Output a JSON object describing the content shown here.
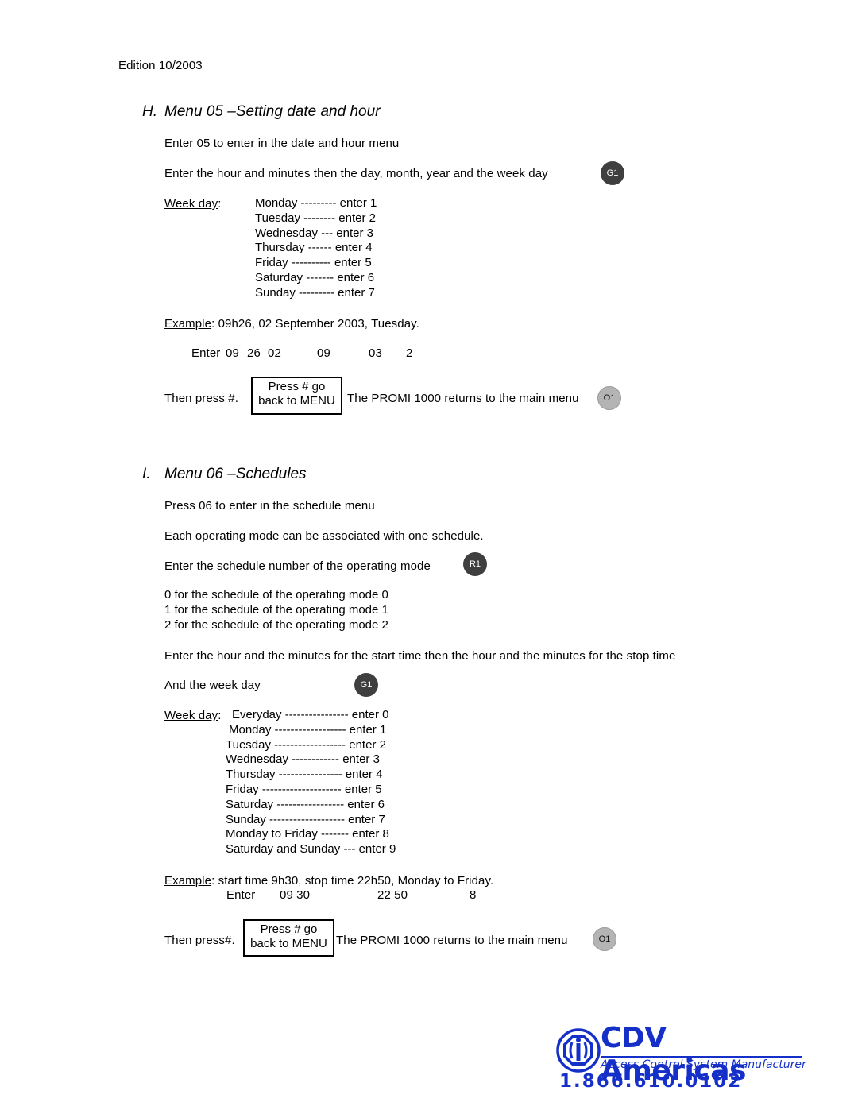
{
  "edition": "Edition 10/2003",
  "section_h": {
    "letter": "H.",
    "title": "Menu 05 –Setting date and hour",
    "intro": "Enter 05 to enter in the date and hour menu",
    "instruction": "Enter the hour and minutes then the day, month, year and the week day",
    "instruction_badge": "G1",
    "weekday_label": "Week day",
    "weekday_colon": ":",
    "weekdays": [
      "Monday --------- enter 1",
      "Tuesday -------- enter 2",
      "Wednesday --- enter 3",
      "Thursday ------ enter 4",
      "Friday ---------- enter 5",
      "Saturday ------- enter 6",
      "Sunday --------- enter 7"
    ],
    "example_label": "Example",
    "example_text": ":  09h26, 02 September 2003, Tuesday.",
    "enter_label": "Enter",
    "enter_values": [
      "09",
      "26",
      "02",
      "09",
      "03",
      "2"
    ],
    "then_press": "Then press #.",
    "menu_box": [
      "Press # go",
      "back to MENU"
    ],
    "returns_text": "The PROMI 1000 returns to the main menu",
    "returns_badge": "O1"
  },
  "section_i": {
    "letter": "I.",
    "title": "Menu 06 –Schedules",
    "intro": "Press 06 to enter in the schedule menu",
    "assoc": "Each operating mode can be associated with one schedule.",
    "schedule_instruction": "Enter the schedule number of the operating mode",
    "schedule_badge": "R1",
    "modes": [
      "0 for the schedule of the operating mode 0",
      "1 for the schedule of the operating mode 1",
      "2 for the schedule of the operating mode 2"
    ],
    "time_instruction": "Enter the hour and the minutes for the start time then the hour and the minutes for the stop time",
    "weekday_prompt": "And the week day",
    "weekday_badge": "G1",
    "weekday_label": "Week day",
    "weekday_colon": ":",
    "weekdays": [
      "Everyday ---------------- enter 0",
      "Monday ------------------ enter 1",
      "Tuesday ------------------ enter 2",
      "Wednesday ------------ enter 3",
      "Thursday ---------------- enter 4",
      "Friday -------------------- enter 5",
      "Saturday ----------------- enter 6",
      "Sunday ------------------- enter 7",
      "Monday to Friday ------- enter 8",
      "Saturday and Sunday --- enter 9"
    ],
    "example_label": "Example",
    "example_text": ": start time 9h30, stop time 22h50, Monday to Friday.",
    "enter_label": "Enter",
    "enter_values": [
      "09  30",
      "22  50",
      "8"
    ],
    "then_press": "Then press#.",
    "menu_box": [
      "Press # go",
      "back to MENU"
    ],
    "returns_text": "The PROMI 1000 returns to the main menu",
    "returns_badge": "O1"
  },
  "logo": {
    "brand": "CDV Americas",
    "tagline": "Access Control System Manufacturer",
    "phone": "1.866.610.0102",
    "color": "#1530c8"
  }
}
